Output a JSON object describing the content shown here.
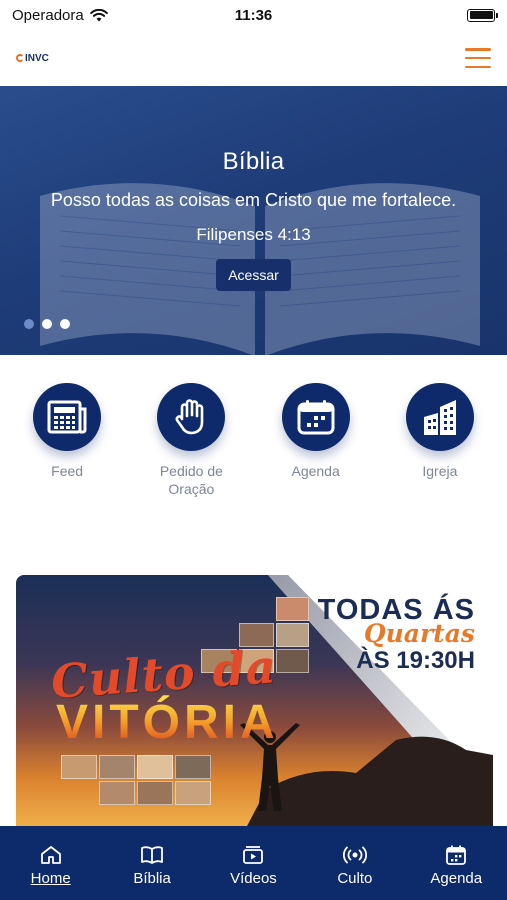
{
  "status_bar": {
    "carrier": "Operadora",
    "time": "11:36"
  },
  "header": {
    "logo_text": "INVC"
  },
  "hero": {
    "title": "Bíblia",
    "verse": "Posso todas as coisas em Cristo que me fortalece.",
    "reference": "Filipenses 4:13",
    "button_label": "Acessar",
    "slides_count": 3,
    "active_slide": 0
  },
  "shortcuts": [
    {
      "label": "Feed",
      "icon": "newspaper-icon"
    },
    {
      "label": "Pedido de Oração",
      "icon": "raised-hand-icon"
    },
    {
      "label": "Agenda",
      "icon": "calendar-icon"
    },
    {
      "label": "Igreja",
      "icon": "buildings-icon"
    }
  ],
  "banner": {
    "line1": "TODAS ÁS",
    "line2": "Quartas",
    "line3": "ÀS 19:30H",
    "title_script": "Culto da",
    "title_bold": "VITÓRIA"
  },
  "tabbar": [
    {
      "label": "Home",
      "icon": "home-icon",
      "active": true
    },
    {
      "label": "Bíblia",
      "icon": "book-icon",
      "active": false
    },
    {
      "label": "Vídeos",
      "icon": "video-icon",
      "active": false
    },
    {
      "label": "Culto",
      "icon": "live-broadcast-icon",
      "active": false
    },
    {
      "label": "Agenda",
      "icon": "calendar-icon",
      "active": false
    }
  ],
  "colors": {
    "primary": "#0d2a6b",
    "accent": "#e8792a",
    "label_gray": "#7d869a"
  }
}
